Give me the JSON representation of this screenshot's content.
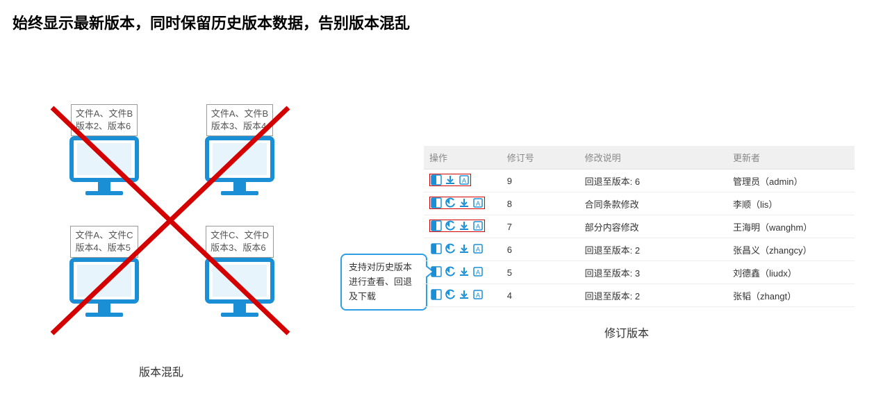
{
  "headline": "始终显示最新版本，同时保留历史版本数据，告别版本混乱",
  "chaos": {
    "stations": [
      {
        "line1": "文件A、文件B",
        "line2": "版本2、版本6"
      },
      {
        "line1": "文件A、文件B",
        "line2": "版本3、版本4"
      },
      {
        "line1": "文件A、文件C",
        "line2": "版本4、版本5"
      },
      {
        "line1": "文件C、文件D",
        "line2": "版本3、版本6"
      }
    ],
    "caption": "版本混乱"
  },
  "callout_text": "支持对历史版本进行查看、回退及下载",
  "version_table": {
    "columns": {
      "ops": "操作",
      "rev": "修订号",
      "desc": "修改说明",
      "updater": "更新者"
    },
    "rows": [
      {
        "rev": "9",
        "desc": "回退至版本: 6",
        "updater": "管理员（admin）",
        "has_revert": false,
        "highlighted": true
      },
      {
        "rev": "8",
        "desc": "合同条款修改",
        "updater": "李顺（lis）",
        "has_revert": true,
        "highlighted": true
      },
      {
        "rev": "7",
        "desc": "部分内容修改",
        "updater": "王海明（wanghm）",
        "has_revert": true,
        "highlighted": true
      },
      {
        "rev": "6",
        "desc": "回退至版本: 2",
        "updater": "张昌义（zhangcy）",
        "has_revert": true,
        "highlighted": false
      },
      {
        "rev": "5",
        "desc": "回退至版本: 3",
        "updater": "刘德鑫（liudx）",
        "has_revert": true,
        "highlighted": false
      },
      {
        "rev": "4",
        "desc": "回退至版本: 2",
        "updater": "张韬（zhangt）",
        "has_revert": true,
        "highlighted": false
      }
    ],
    "caption": "修订版本"
  },
  "colors": {
    "accent_blue": "#1b8fd6",
    "cross_red": "#d40000"
  }
}
